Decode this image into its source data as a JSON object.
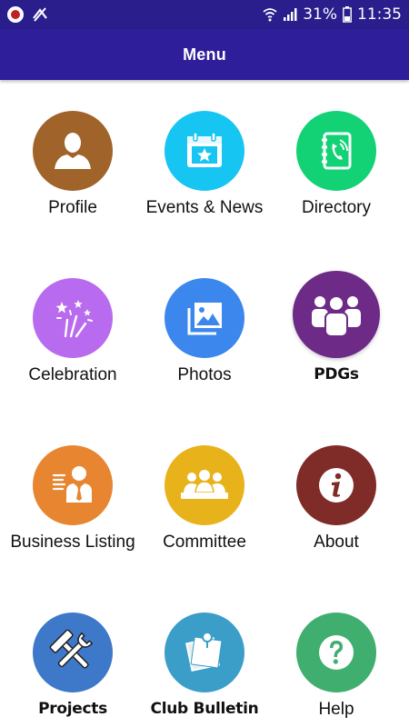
{
  "status_bar": {
    "battery": "31%",
    "time": "11:35"
  },
  "app_bar": {
    "title": "Menu"
  },
  "menu": [
    {
      "label": "Profile",
      "icon": "person-icon",
      "color": "#a0632a"
    },
    {
      "label": "Events & News",
      "icon": "calendar-star-icon",
      "color": "#16c5f2"
    },
    {
      "label": "Directory",
      "icon": "phone-book-icon",
      "color": "#12d275"
    },
    {
      "label": "Celebration",
      "icon": "fireworks-icon",
      "color": "#b86bee"
    },
    {
      "label": "Photos",
      "icon": "photos-icon",
      "color": "#3b87ee"
    },
    {
      "label": "PDGs",
      "icon": "group-icon",
      "color": "#6d2a87"
    },
    {
      "label": "Business Listing",
      "icon": "business-person-icon",
      "color": "#e78531"
    },
    {
      "label": "Committee",
      "icon": "committee-icon",
      "color": "#e8b21a"
    },
    {
      "label": "About",
      "icon": "info-icon",
      "color": "#7f2b28"
    },
    {
      "label": "Projects",
      "icon": "tools-icon",
      "color": "#3e78c8"
    },
    {
      "label": "Club Bulletin",
      "icon": "bulletin-icon",
      "color": "#3a9ec8"
    },
    {
      "label": "Help",
      "icon": "help-icon",
      "color": "#3fae6f"
    }
  ]
}
